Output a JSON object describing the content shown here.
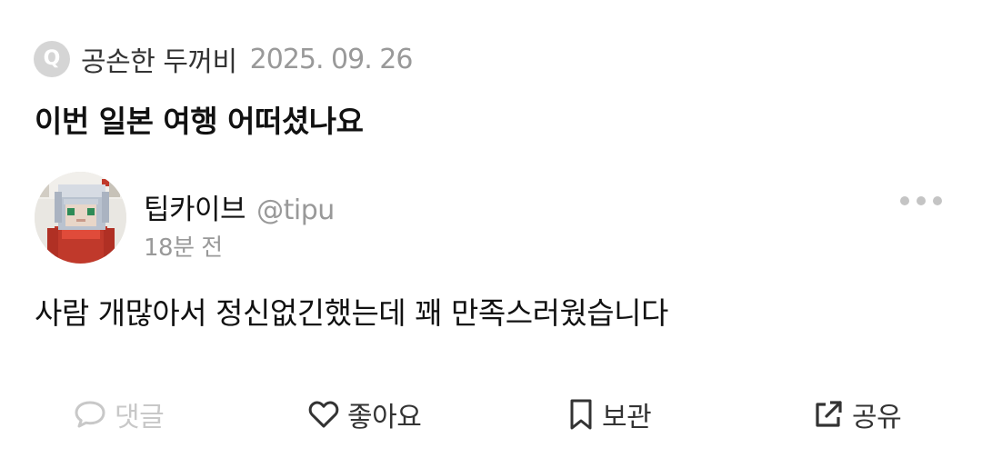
{
  "question": {
    "badge": "Q",
    "asker_name": "공손한 두꺼비",
    "date": "2025. 09. 26",
    "text": "이번 일본 여행 어떠셨나요"
  },
  "answer": {
    "author_name": "팁카이브",
    "author_handle": "@tipu",
    "time_ago": "18분 전",
    "text": "사람 개많아서 정신없긴했는데 꽤 만족스러웠습니다",
    "avatar_icon": "minecraft-skin-avatar",
    "more_icon": "more-dots-icon"
  },
  "actions": {
    "comment_label": "댓글",
    "like_label": "좋아요",
    "save_label": "보관",
    "share_label": "공유",
    "comment_icon": "speech-bubble-icon",
    "like_icon": "heart-icon",
    "save_icon": "bookmark-icon",
    "share_icon": "external-share-icon"
  },
  "colors": {
    "text_primary": "#111111",
    "text_secondary": "#999999",
    "disabled": "#c8c8c8",
    "badge_bg": "#d5d5d5"
  }
}
